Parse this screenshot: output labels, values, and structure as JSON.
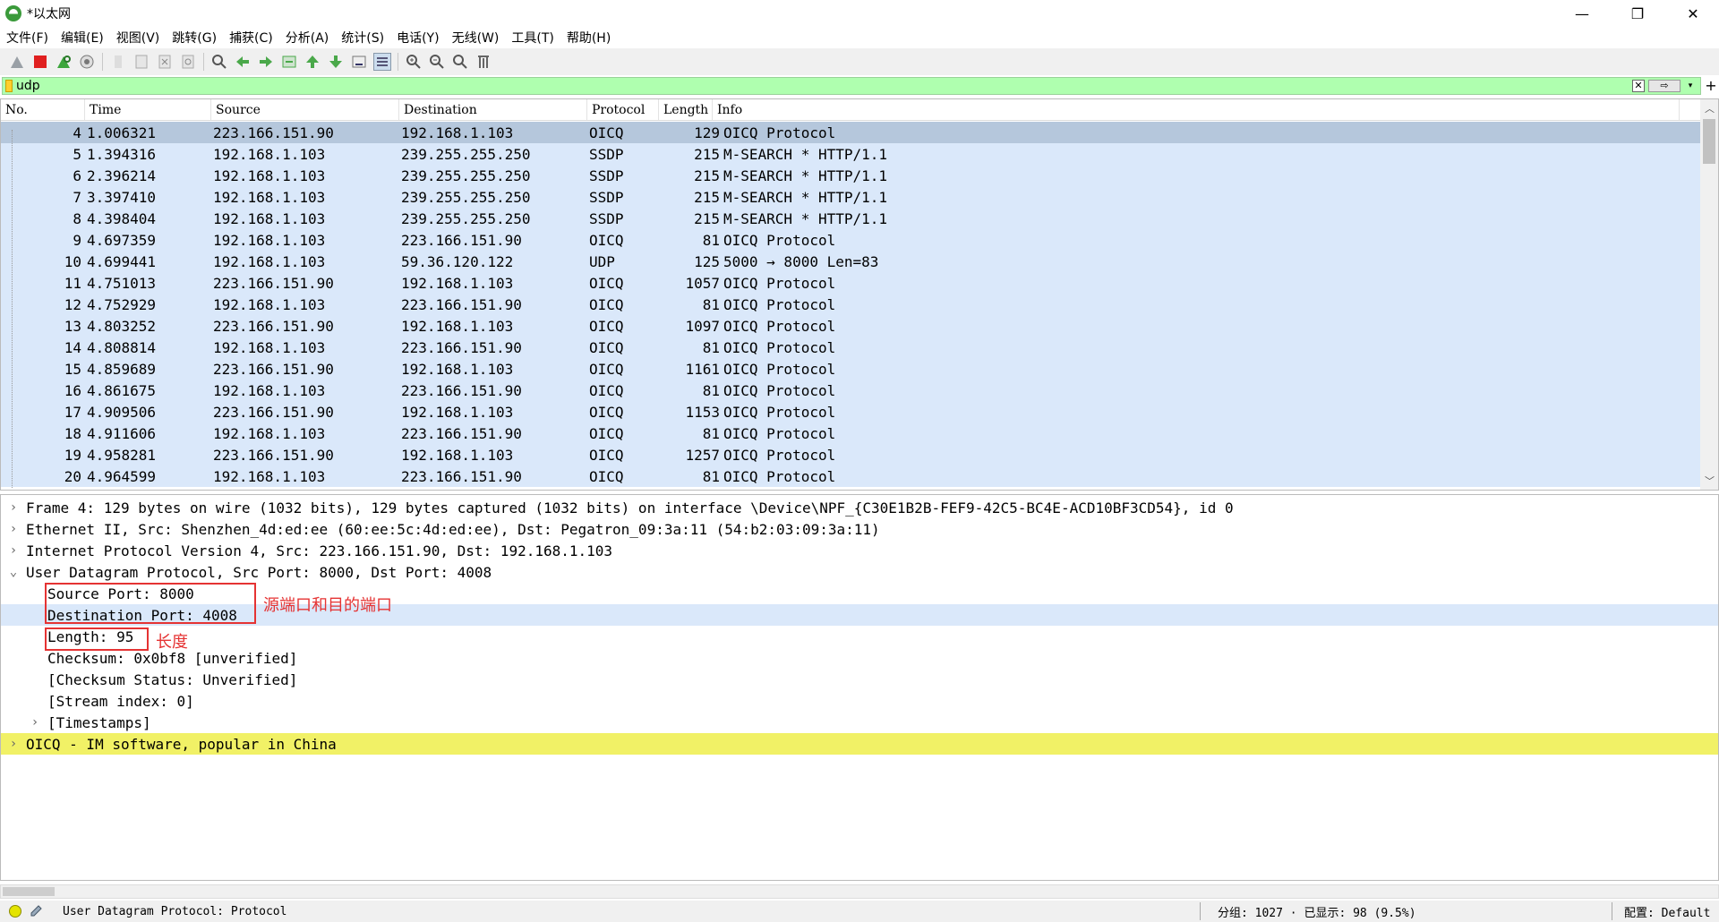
{
  "window": {
    "title": "*以太网",
    "min": "—",
    "restore": "❐",
    "close": "✕"
  },
  "menu": [
    "文件(F)",
    "编辑(E)",
    "视图(V)",
    "跳转(G)",
    "捕获(C)",
    "分析(A)",
    "统计(S)",
    "电话(Y)",
    "无线(W)",
    "工具(T)",
    "帮助(H)"
  ],
  "filter": {
    "value": "udp",
    "clear": "✕",
    "apply": "⇨",
    "dropdown": "▾",
    "add": "+"
  },
  "columns": [
    "No.",
    "Time",
    "Source",
    "Destination",
    "Protocol",
    "Length",
    "Info"
  ],
  "packets": [
    {
      "no": "4",
      "time": "1.006321",
      "src": "223.166.151.90",
      "dst": "192.168.1.103",
      "proto": "OICQ",
      "len": "129",
      "info": "OICQ Protocol"
    },
    {
      "no": "5",
      "time": "1.394316",
      "src": "192.168.1.103",
      "dst": "239.255.255.250",
      "proto": "SSDP",
      "len": "215",
      "info": "M-SEARCH * HTTP/1.1"
    },
    {
      "no": "6",
      "time": "2.396214",
      "src": "192.168.1.103",
      "dst": "239.255.255.250",
      "proto": "SSDP",
      "len": "215",
      "info": "M-SEARCH * HTTP/1.1"
    },
    {
      "no": "7",
      "time": "3.397410",
      "src": "192.168.1.103",
      "dst": "239.255.255.250",
      "proto": "SSDP",
      "len": "215",
      "info": "M-SEARCH * HTTP/1.1"
    },
    {
      "no": "8",
      "time": "4.398404",
      "src": "192.168.1.103",
      "dst": "239.255.255.250",
      "proto": "SSDP",
      "len": "215",
      "info": "M-SEARCH * HTTP/1.1"
    },
    {
      "no": "9",
      "time": "4.697359",
      "src": "192.168.1.103",
      "dst": "223.166.151.90",
      "proto": "OICQ",
      "len": "81",
      "info": "OICQ Protocol"
    },
    {
      "no": "10",
      "time": "4.699441",
      "src": "192.168.1.103",
      "dst": "59.36.120.122",
      "proto": "UDP",
      "len": "125",
      "info": "5000 → 8000 Len=83"
    },
    {
      "no": "11",
      "time": "4.751013",
      "src": "223.166.151.90",
      "dst": "192.168.1.103",
      "proto": "OICQ",
      "len": "1057",
      "info": "OICQ Protocol"
    },
    {
      "no": "12",
      "time": "4.752929",
      "src": "192.168.1.103",
      "dst": "223.166.151.90",
      "proto": "OICQ",
      "len": "81",
      "info": "OICQ Protocol"
    },
    {
      "no": "13",
      "time": "4.803252",
      "src": "223.166.151.90",
      "dst": "192.168.1.103",
      "proto": "OICQ",
      "len": "1097",
      "info": "OICQ Protocol"
    },
    {
      "no": "14",
      "time": "4.808814",
      "src": "192.168.1.103",
      "dst": "223.166.151.90",
      "proto": "OICQ",
      "len": "81",
      "info": "OICQ Protocol"
    },
    {
      "no": "15",
      "time": "4.859689",
      "src": "223.166.151.90",
      "dst": "192.168.1.103",
      "proto": "OICQ",
      "len": "1161",
      "info": "OICQ Protocol"
    },
    {
      "no": "16",
      "time": "4.861675",
      "src": "192.168.1.103",
      "dst": "223.166.151.90",
      "proto": "OICQ",
      "len": "81",
      "info": "OICQ Protocol"
    },
    {
      "no": "17",
      "time": "4.909506",
      "src": "223.166.151.90",
      "dst": "192.168.1.103",
      "proto": "OICQ",
      "len": "1153",
      "info": "OICQ Protocol"
    },
    {
      "no": "18",
      "time": "4.911606",
      "src": "192.168.1.103",
      "dst": "223.166.151.90",
      "proto": "OICQ",
      "len": "81",
      "info": "OICQ Protocol"
    },
    {
      "no": "19",
      "time": "4.958281",
      "src": "223.166.151.90",
      "dst": "192.168.1.103",
      "proto": "OICQ",
      "len": "1257",
      "info": "OICQ Protocol"
    },
    {
      "no": "20",
      "time": "4.964599",
      "src": "192.168.1.103",
      "dst": "223.166.151.90",
      "proto": "OICQ",
      "len": "81",
      "info": "OICQ Protocol"
    }
  ],
  "details": [
    {
      "level": 0,
      "exp": "›",
      "text": "Frame 4: 129 bytes on wire (1032 bits), 129 bytes captured (1032 bits) on interface \\Device\\NPF_{C30E1B2B-FEF9-42C5-BC4E-ACD10BF3CD54}, id 0"
    },
    {
      "level": 0,
      "exp": "›",
      "text": "Ethernet II, Src: Shenzhen_4d:ed:ee (60:ee:5c:4d:ed:ee), Dst: Pegatron_09:3a:11 (54:b2:03:09:3a:11)"
    },
    {
      "level": 0,
      "exp": "›",
      "text": "Internet Protocol Version 4, Src: 223.166.151.90, Dst: 192.168.1.103"
    },
    {
      "level": 0,
      "exp": "⌄",
      "text": "User Datagram Protocol, Src Port: 8000, Dst Port: 4008"
    },
    {
      "level": 1,
      "exp": "",
      "text": "Source Port: 8000"
    },
    {
      "level": 1,
      "exp": "",
      "text": "Destination Port: 4008"
    },
    {
      "level": 1,
      "exp": "",
      "text": "Length: 95"
    },
    {
      "level": 1,
      "exp": "",
      "text": "Checksum: 0x0bf8 [unverified]"
    },
    {
      "level": 1,
      "exp": "",
      "text": "[Checksum Status: Unverified]"
    },
    {
      "level": 1,
      "exp": "",
      "text": "[Stream index: 0]"
    },
    {
      "level": 1,
      "exp": "›",
      "text": "[Timestamps]"
    },
    {
      "level": 0,
      "exp": "›",
      "text": "OICQ - IM software, popular in China"
    }
  ],
  "annotations": {
    "ports": "源端口和目的端口",
    "length": "长度"
  },
  "status": {
    "message": "User Datagram Protocol: Protocol",
    "packets": "分组: 1027 · 已显示: 98 (9.5%)",
    "profile": "配置: Default"
  },
  "colors": {
    "row_bg": "#dae8fa",
    "selected_bg": "#b5c7dc",
    "filter_bg": "#afffaf",
    "highlight": "#f1f166",
    "annotation": "#e53333"
  }
}
